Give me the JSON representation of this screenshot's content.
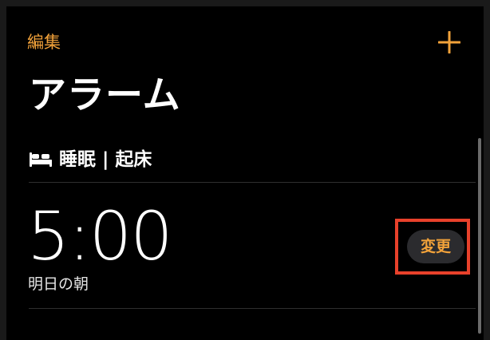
{
  "header": {
    "edit_label": "編集",
    "add_icon": "plus-icon",
    "title": "アラーム"
  },
  "sleep_section": {
    "icon": "bed-icon",
    "title": "睡眠 | 起床"
  },
  "alarm": {
    "time": "5:00",
    "subtitle": "明日の朝",
    "change_label": "変更"
  },
  "colors": {
    "accent": "#f2a23a",
    "background": "#000000",
    "highlight": "#e8412b",
    "button_bg": "#2b2b2e"
  }
}
